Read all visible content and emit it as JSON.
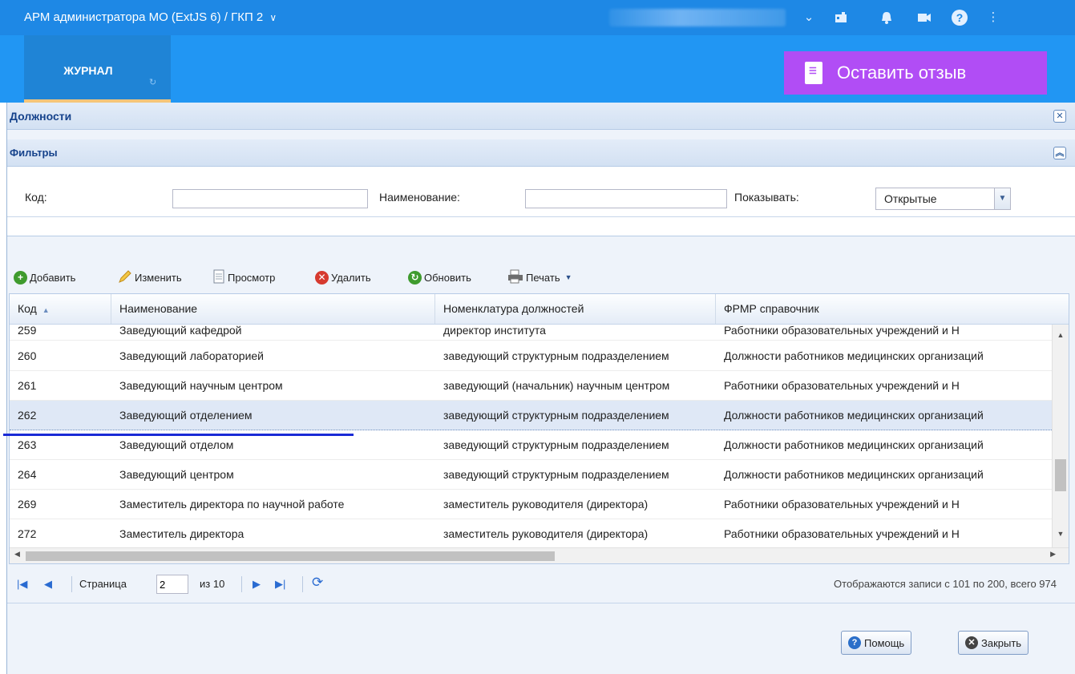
{
  "app": {
    "title": "АРМ администратора МО (ExtJS 6) / ГКП 2",
    "title_chevron": "∨",
    "top_icons": [
      "chevron-down-icon",
      "tablet-icon",
      "bell-icon",
      "video-icon",
      "help-icon",
      "more-vert-icon"
    ]
  },
  "nav": {
    "tab_journal": "ЖУРНАЛ",
    "feedback_button": "Оставить отзыв"
  },
  "window": {
    "title": "Должности",
    "filters_title": "Фильтры"
  },
  "filters": {
    "code_label": "Код:",
    "code_value": "",
    "name_label": "Наименование:",
    "name_value": "",
    "show_label": "Показывать:",
    "show_value": "Открытые"
  },
  "toolbar": {
    "add": "Добавить",
    "edit": "Изменить",
    "view": "Просмотр",
    "delete": "Удалить",
    "refresh": "Обновить",
    "print": "Печать"
  },
  "grid": {
    "columns": [
      "Код",
      "Наименование",
      "Номенклатура должностей",
      "ФРМР справочник"
    ],
    "sort_indicator": "▲",
    "rows": [
      {
        "code": "259",
        "name": "Заведующий кафедрой",
        "nomenclature": "директор института",
        "frmr": "Работники образовательных учреждений и Н"
      },
      {
        "code": "260",
        "name": "Заведующий лабораторией",
        "nomenclature": "заведующий структурным подразделением",
        "frmr": "Должности работников медицинских организаций"
      },
      {
        "code": "261",
        "name": "Заведующий научным центром",
        "nomenclature": "заведующий (начальник) научным центром",
        "frmr": "Работники образовательных учреждений и Н"
      },
      {
        "code": "262",
        "name": "Заведующий отделением",
        "nomenclature": "заведующий структурным подразделением",
        "frmr": "Должности работников медицинских организаций"
      },
      {
        "code": "263",
        "name": "Заведующий отделом",
        "nomenclature": "заведующий структурным подразделением",
        "frmr": "Должности работников медицинских организаций"
      },
      {
        "code": "264",
        "name": "Заведующий центром",
        "nomenclature": "заведующий структурным подразделением",
        "frmr": "Должности работников медицинских организаций"
      },
      {
        "code": "269",
        "name": "Заместитель директора по научной работе",
        "nomenclature": "заместитель руководителя (директора)",
        "frmr": "Работники образовательных учреждений и Н"
      },
      {
        "code": "272",
        "name": "Заместитель директора",
        "nomenclature": "заместитель руководителя (директора)",
        "frmr": "Работники образовательных учреждений и Н"
      }
    ],
    "selected_row_index": 3
  },
  "pager": {
    "page_label": "Страница",
    "page_value": "2",
    "of_label": "из 10",
    "info": "Отображаются записи с 101 по 200, всего 974"
  },
  "footer": {
    "help": "Помощь",
    "close": "Закрыть"
  },
  "colors": {
    "topbar": "#1e88e5",
    "navbar": "#2196f3",
    "feedback": "#b14df5",
    "selection_line": "#1a2bd6"
  }
}
